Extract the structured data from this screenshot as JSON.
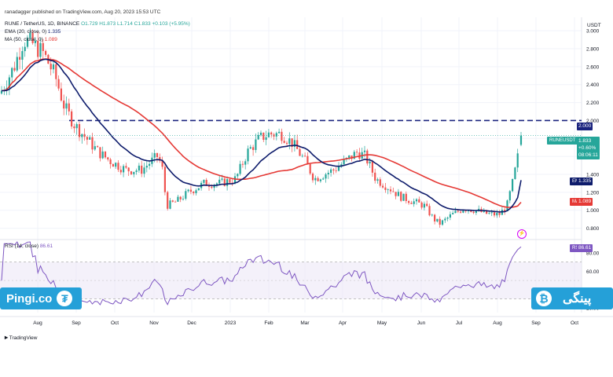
{
  "header": {
    "credit": "ranadagger published on TradingView.com, Aug 20, 2023 15:53 UTC",
    "symbol_line": "RUNE / TetherUS, 1D, BINANCE",
    "ohlc": "O1.729 H1.873 L1.714 C1.833 +0.103 (+5.95%)",
    "ema_line": "EMA (20, close, 0)",
    "ema_value": "1.335",
    "ma_line": "MA (50, close, 0)",
    "ma_value": "1.089"
  },
  "price_axis": {
    "currency": "USDT",
    "ticks": [
      "3.000",
      "2.800",
      "2.600",
      "2.400",
      "2.200",
      "2.000",
      "1.800",
      "1.600",
      "1.400",
      "1.200",
      "1.000",
      "0.800"
    ]
  },
  "rsi_panel": {
    "label": "RSI (14, close)",
    "value": "86.61",
    "ticks": [
      "80.00",
      "60.00",
      "40.00",
      "20.00"
    ]
  },
  "tags": {
    "current_symbol": "RUNEUSDT",
    "current_price": "1.833",
    "current_change": "+0.60%",
    "countdown": "08:06:11",
    "level": "2.000",
    "ema_label": "EMA",
    "ema": "1.335",
    "ma_label": "MA",
    "ma": "1.089",
    "rsi_label": "RSI",
    "rsi": "86.61"
  },
  "time_axis": [
    "Aug",
    "Sep",
    "Oct",
    "Nov",
    "Dec",
    "2023",
    "Feb",
    "Mar",
    "Apr",
    "May",
    "Jun",
    "Jul",
    "Aug",
    "Sep",
    "Oct"
  ],
  "branding": {
    "left": "Pingi.co",
    "right": "پینگی",
    "footer": "TradingView"
  },
  "colors": {
    "up": "#26a69a",
    "down": "#ef5350",
    "ema": "#0d1b6b",
    "ma": "#e53935",
    "rsi": "#7e57c2",
    "level_line": "#1a237e",
    "brand": "#25a0d8"
  },
  "chart_data": [
    {
      "type": "candlestick",
      "title": "RUNE / TetherUS, 1D, BINANCE",
      "x": [
        "Aug",
        "Sep",
        "Oct",
        "Nov",
        "Dec",
        "2023",
        "Feb",
        "Mar",
        "Apr",
        "May",
        "Jun",
        "Jul",
        "Aug"
      ],
      "series": [
        {
          "name": "RUNEUSDT",
          "values": [
            2.75,
            2.0,
            1.6,
            1.5,
            1.25,
            1.3,
            1.85,
            1.55,
            1.6,
            1.15,
            0.95,
            1.05,
            1.833
          ]
        },
        {
          "name": "EMA (20, close, 0)",
          "values": [
            2.65,
            2.0,
            1.6,
            1.5,
            1.2,
            1.3,
            1.75,
            1.6,
            1.55,
            1.2,
            0.95,
            1.0,
            1.335
          ]
        },
        {
          "name": "MA (50, close, 0)",
          "values": [
            2.3,
            2.05,
            1.7,
            1.5,
            1.3,
            1.3,
            1.6,
            1.7,
            1.55,
            1.3,
            1.05,
            0.98,
            1.089
          ]
        }
      ],
      "horizontal_line": 2.0,
      "ylim": [
        0.7,
        3.15
      ],
      "y_ticks": [
        3.0,
        2.8,
        2.6,
        2.4,
        2.2,
        2.0,
        1.8,
        1.6,
        1.4,
        1.2,
        1.0,
        0.8
      ],
      "last": {
        "open": 1.729,
        "high": 1.873,
        "low": 1.714,
        "close": 1.833,
        "change": 0.103,
        "change_pct": 5.95
      },
      "legend": "top-left",
      "grid": true
    },
    {
      "type": "line",
      "title": "RSI (14, close)",
      "x": [
        "Aug",
        "Sep",
        "Oct",
        "Nov",
        "Dec",
        "2023",
        "Feb",
        "Mar",
        "Apr",
        "May",
        "Jun",
        "Jul",
        "Aug"
      ],
      "series": [
        {
          "name": "RSI (14, close)",
          "values": [
            62,
            45,
            40,
            32,
            52,
            48,
            68,
            45,
            58,
            35,
            22,
            48,
            86.61
          ]
        }
      ],
      "bands": [
        70,
        30
      ],
      "ylim": [
        15,
        92
      ],
      "y_ticks": [
        80,
        60,
        40,
        20
      ]
    }
  ]
}
